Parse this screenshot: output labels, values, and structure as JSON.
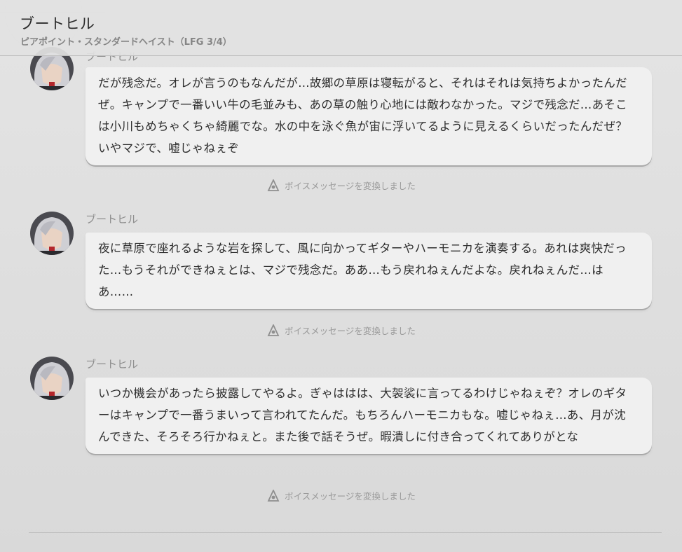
{
  "header": {
    "title": "ブートヒル",
    "subtitle": "ピアポイント・スタンダードヘイスト（LFG 3/4）"
  },
  "messages": [
    {
      "sender": "ブートヒル",
      "text": "だが残念だ。オレが言うのもなんだが…故郷の草原は寝転がると、それはそれは気持ちよかったんだぜ。キャンプで一番いい牛の毛並みも、あの草の触り心地には敵わなかった。マジで残念だ…あそこは小川もめちゃくちゃ綺麗でな。水の中を泳ぐ魚が宙に浮いてるように見えるくらいだったんだぜ？いやマジで、嘘じゃねぇぞ",
      "voice_note": "ボイスメッセージを変換しました"
    },
    {
      "sender": "ブートヒル",
      "text": "夜に草原で座れるような岩を探して、風に向かってギターやハーモニカを演奏する。あれは爽快だった…もうそれができねぇとは、マジで残念だ。ああ…もう戻れねぇんだよな。戻れねぇんだ…はあ……",
      "voice_note": "ボイスメッセージを変換しました"
    },
    {
      "sender": "ブートヒル",
      "text": "いつか機会があったら披露してやるよ。ぎゃははは、大袈裟に言ってるわけじゃねぇぞ？オレのギターはキャンプで一番うまいって言われてたんだ。もちろんハーモニカもな。嘘じゃねぇ…あ、月が沈んできた、そろそろ行かねぇと。また後で話そうぜ。暇潰しに付き合ってくれてありがとな",
      "voice_note": "ボイスメッセージを変換しました"
    }
  ],
  "icons": {
    "avatar": "avatar-boothill",
    "voice": "voice-convert-icon"
  },
  "colors": {
    "bubble": "#f0f0f0",
    "background": "#e0e0e0",
    "muted_text": "#9a9a9a"
  }
}
